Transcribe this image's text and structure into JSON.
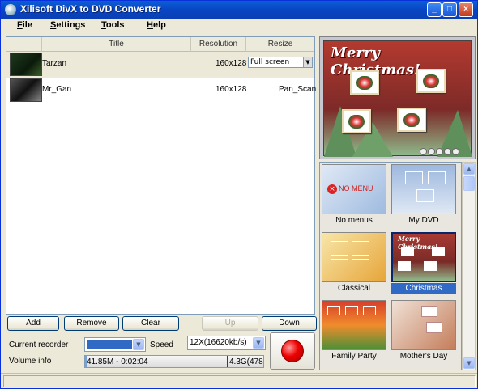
{
  "window": {
    "title": "Xilisoft DivX to DVD Converter",
    "min": "_",
    "max": "□",
    "close": "×"
  },
  "menu": [
    "File",
    "Settings",
    "Tools",
    "Help"
  ],
  "list": {
    "columns": [
      "Title",
      "Resolution",
      "Resize"
    ],
    "rows": [
      {
        "title": "Tarzan",
        "resolution": "160x128",
        "resize": "Full screen"
      },
      {
        "title": "Mr_Gan",
        "resolution": "160x128",
        "resize": "Pan_Scan"
      }
    ]
  },
  "buttons": {
    "add": "Add",
    "remove": "Remove",
    "clear": "Clear",
    "up": "Up",
    "down": "Down"
  },
  "controls": {
    "current_recorder_label": "Current recorder",
    "current_recorder_value": "",
    "speed_label": "Speed",
    "speed_value": "12X(16620kb/s)",
    "volume_label": "Volume info",
    "volume_used": "41.85M - 0:02:04",
    "volume_total": "4.3G(478",
    "volume_fraction": 0.01
  },
  "preview": {
    "heading": "Merry Christmas!"
  },
  "templates": [
    {
      "name": "No menus",
      "text": "NO MENU"
    },
    {
      "name": "My DVD"
    },
    {
      "name": "Classical"
    },
    {
      "name": "Christmas",
      "text": "Merry Christmas!",
      "selected": true
    },
    {
      "name": "Family Party"
    },
    {
      "name": "Mother's Day"
    }
  ],
  "colors": {
    "selected_caption": "#316ac5",
    "title_bar": "#0a5fd6",
    "record": "#ee0000"
  }
}
